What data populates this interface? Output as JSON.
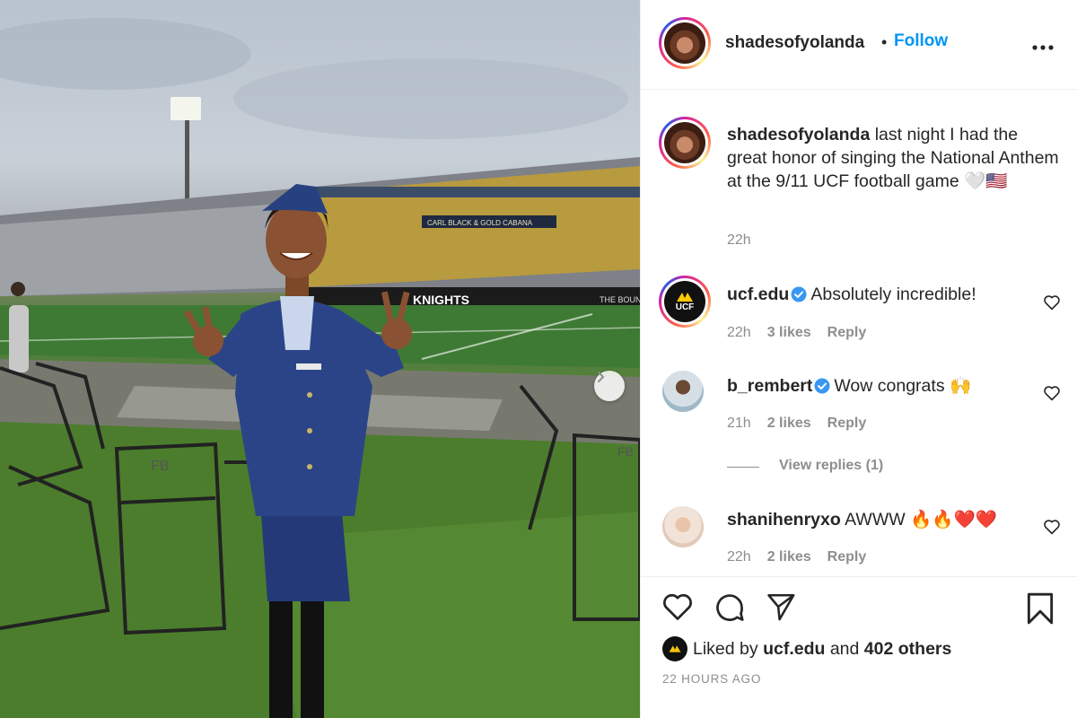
{
  "post": {
    "username": "shadesofyolanda",
    "follow_label": "Follow",
    "dot": "•",
    "more_label": "•••",
    "caption": {
      "username": "shadesofyolanda",
      "text": " last night I had the great honor of singing the National Anthem at the 9/11 UCF football game 🤍🇺🇸",
      "time": "22h"
    }
  },
  "comments": [
    {
      "username": "ucf.edu",
      "verified": true,
      "text": "Absolutely incredible!",
      "time": "22h",
      "likes": "3 likes",
      "reply": "Reply",
      "avatar": "ucf-logo"
    },
    {
      "username": "b_rembert",
      "verified": true,
      "text": "Wow congrats 🙌",
      "time": "21h",
      "likes": "2 likes",
      "reply": "Reply",
      "avatar": "b-rembert-photo",
      "view_replies": "View replies (1)"
    },
    {
      "username": "shanihenryxo",
      "verified": false,
      "text": "AWWW 🔥🔥❤️❤️",
      "time": "22h",
      "likes": "2 likes",
      "reply": "Reply",
      "avatar": "shanihenryxo-photo"
    }
  ],
  "likes_line": {
    "prefix": "Liked by ",
    "user": "ucf.edu",
    "middle": " and ",
    "count": "402 others"
  },
  "timestamp": "22 HOURS AGO",
  "ucf_logo_text": "UCF",
  "photo": {
    "banner_text": "CARL BLACK & GOLD CABANA",
    "knights_text": "KNIGHTS",
    "bounce_text": "THE BOUN",
    "chair_text": "FB"
  },
  "icons": {
    "like": "heart-icon",
    "comment": "comment-icon",
    "share": "share-icon",
    "save": "bookmark-icon",
    "next": "chevron-right-icon"
  },
  "colors": {
    "accent": "#0095f6",
    "muted": "#8e8e8e",
    "text": "#262626",
    "verified": "#3897f0"
  }
}
